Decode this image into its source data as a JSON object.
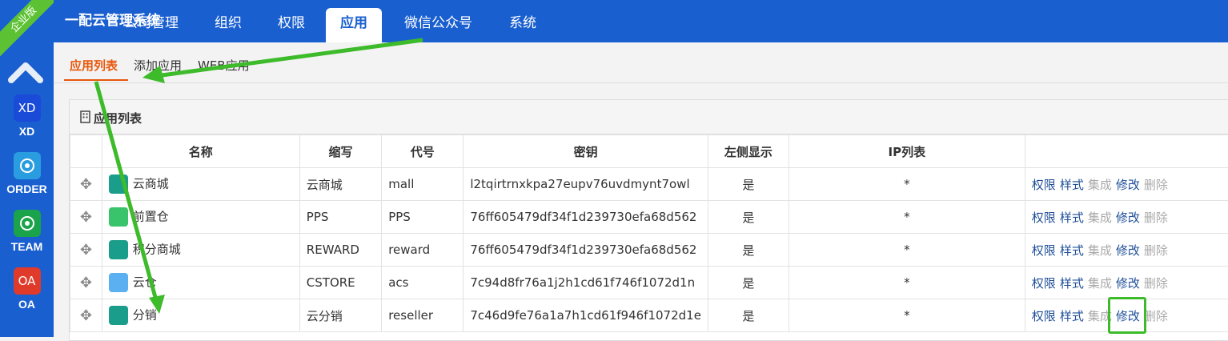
{
  "edition_ribbon": "企业版",
  "rail_apps": [
    {
      "tile": "XD",
      "label": "XD",
      "color": "#1a4ad8",
      "icon": "xd-tile-icon"
    },
    {
      "tile": "",
      "label": "ORDER",
      "color": "#2a9ce0",
      "icon": "order-tile-icon"
    },
    {
      "tile": "",
      "label": "TEAM",
      "color": "#1aa34a",
      "icon": "team-tile-icon"
    },
    {
      "tile": "OA",
      "label": "OA",
      "color": "#e03a2a",
      "icon": "oa-tile-icon"
    }
  ],
  "brand": "一配云管理系统",
  "nav_tabs": [
    "公司管理",
    "组织",
    "权限",
    "应用",
    "微信公众号",
    "系统"
  ],
  "active_nav": "应用",
  "sub_tabs": [
    "应用列表",
    "添加应用",
    "WEB应用"
  ],
  "panel_title": "应用列表",
  "columns": [
    "名称",
    "缩写",
    "代号",
    "密钥",
    "左侧显示",
    "IP列表",
    ""
  ],
  "rows": [
    {
      "name": "云商城",
      "abbr": "云商城",
      "code": "mall",
      "key": "l2tqirtrnxkpa27eupv76uvdmynt7owl",
      "left": "是",
      "ip": "*",
      "color": "#1a9d8a"
    },
    {
      "name": "前置仓",
      "abbr": "PPS",
      "code": "PPS",
      "key": "76ff605479df34f1d239730efa68d562",
      "left": "是",
      "ip": "*",
      "color": "#39c36a"
    },
    {
      "name": "积分商城",
      "abbr": "REWARD",
      "code": "reward",
      "key": "76ff605479df34f1d239730efa68d562",
      "left": "是",
      "ip": "*",
      "color": "#1a9d8a"
    },
    {
      "name": "云仓",
      "abbr": "CSTORE",
      "code": "acs",
      "key": "7c94d8fr76a1j2h1cd61f746f1072d1n",
      "left": "是",
      "ip": "*",
      "color": "#5ab0f0"
    },
    {
      "name": "分销",
      "abbr": "云分销",
      "code": "reseller",
      "key": "7c46d9fe76a1a7h1cd61f946f1072d1e",
      "left": "是",
      "ip": "*",
      "color": "#1a9d8a"
    }
  ],
  "actions": [
    "权限",
    "样式",
    "集成",
    "修改",
    "删除"
  ],
  "colors": {
    "primary": "#1a5fd0",
    "accent": "#e8580c",
    "annotation": "#3dbb2a",
    "link": "#1f4f99",
    "disabled": "#aaaaaa"
  }
}
